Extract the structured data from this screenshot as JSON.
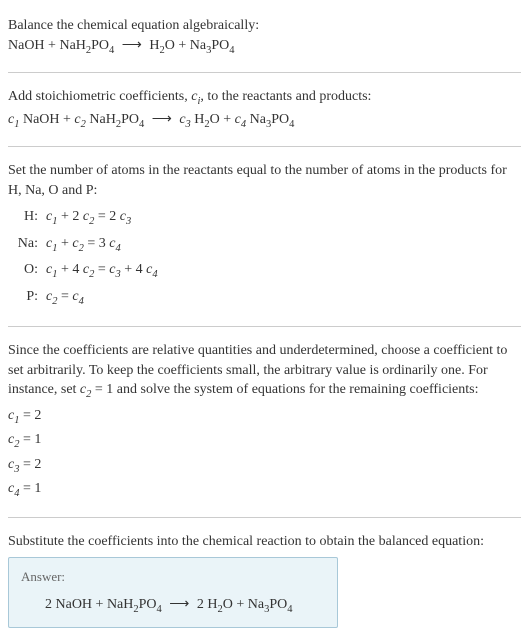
{
  "intro": {
    "line1": "Balance the chemical equation algebraically:",
    "eq_lhs1": "NaOH",
    "eq_plus1": " + ",
    "eq_lhs2": "NaH",
    "eq_lhs2_sub": "2",
    "eq_lhs3": "PO",
    "eq_lhs3_sub": "4",
    "arrow": " ⟶ ",
    "eq_rhs1": "H",
    "eq_rhs1_sub": "2",
    "eq_rhs2": "O + Na",
    "eq_rhs2_sub": "3",
    "eq_rhs3": "PO",
    "eq_rhs3_sub": "4"
  },
  "step1": {
    "text1": "Add stoichiometric coefficients, ",
    "ci": "c",
    "ci_sub": "i",
    "text2": ", to the reactants and products:",
    "c1": "c",
    "c1_sub": "1",
    "sp1": " NaOH + ",
    "c2": "c",
    "c2_sub": "2",
    "sp2": " NaH",
    "sp2_sub": "2",
    "sp3": "PO",
    "sp3_sub": "4",
    "arrow": " ⟶ ",
    "c3": "c",
    "c3_sub": "3",
    "sp4": " H",
    "sp4_sub": "2",
    "sp5": "O + ",
    "c4": "c",
    "c4_sub": "4",
    "sp6": " Na",
    "sp6_sub": "3",
    "sp7": "PO",
    "sp7_sub": "4"
  },
  "step2": {
    "text": "Set the number of atoms in the reactants equal to the number of atoms in the products for H, Na, O and P:",
    "rows": [
      {
        "label": "H:",
        "c1": "c",
        "c1s": "1",
        "t1": " + 2 ",
        "c2": "c",
        "c2s": "2",
        "t2": " = 2 ",
        "c3": "c",
        "c3s": "3",
        "t3": ""
      },
      {
        "label": "Na:",
        "c1": "c",
        "c1s": "1",
        "t1": " + ",
        "c2": "c",
        "c2s": "2",
        "t2": " = 3 ",
        "c3": "c",
        "c3s": "4",
        "t3": ""
      },
      {
        "label": "O:",
        "c1": "c",
        "c1s": "1",
        "t1": " + 4 ",
        "c2": "c",
        "c2s": "2",
        "t2": " = ",
        "c3": "c",
        "c3s": "3",
        "t3a": " + 4 ",
        "c4": "c",
        "c4s": "4"
      },
      {
        "label": "P:",
        "c1": "c",
        "c1s": "2",
        "t1": " = ",
        "c2": "c",
        "c2s": "4",
        "t2": "",
        "c3": "",
        "c3s": "",
        "t3": ""
      }
    ]
  },
  "step3": {
    "text1": "Since the coefficients are relative quantities and underdetermined, choose a coefficient to set arbitrarily. To keep the coefficients small, the arbitrary value is ordinarily one. For instance, set ",
    "cv": "c",
    "cv_sub": "2",
    "text2": " = 1 and solve the system of equations for the remaining coefficients:",
    "coefs": [
      {
        "c": "c",
        "s": "1",
        "v": " = 2"
      },
      {
        "c": "c",
        "s": "2",
        "v": " = 1"
      },
      {
        "c": "c",
        "s": "3",
        "v": " = 2"
      },
      {
        "c": "c",
        "s": "4",
        "v": " = 1"
      }
    ]
  },
  "step4": {
    "text": "Substitute the coefficients into the chemical reaction to obtain the balanced equation:"
  },
  "answer": {
    "label": "Answer:",
    "p1": "2 NaOH + NaH",
    "s1": "2",
    "p2": "PO",
    "s2": "4",
    "arrow": " ⟶ ",
    "p3": "2 H",
    "s3": "2",
    "p4": "O + Na",
    "s4": "3",
    "p5": "PO",
    "s5": "4"
  }
}
